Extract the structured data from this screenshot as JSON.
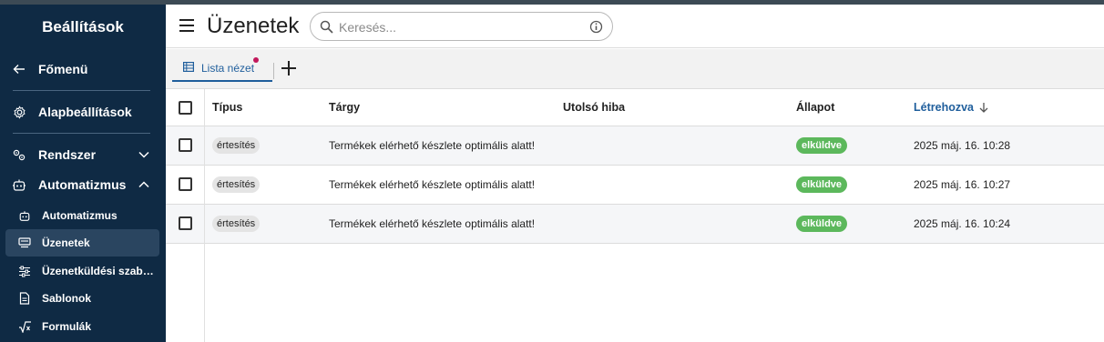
{
  "sidebar": {
    "title": "Beállítások",
    "back_label": "Főmenü",
    "items": [
      {
        "label": "Alapbeállítások"
      },
      {
        "label": "Rendszer"
      },
      {
        "label": "Automatizmus"
      }
    ],
    "subitems": [
      {
        "label": "Automatizmus"
      },
      {
        "label": "Üzenetek"
      },
      {
        "label": "Üzenetküldési szabályok"
      },
      {
        "label": "Sablonok"
      },
      {
        "label": "Formulák"
      }
    ]
  },
  "header": {
    "title": "Üzenetek",
    "search_placeholder": "Keresés..."
  },
  "tabs": [
    {
      "label": "Lista nézet"
    }
  ],
  "table": {
    "columns": {
      "type": "Típus",
      "subject": "Tárgy",
      "last_error": "Utolsó hiba",
      "status": "Állapot",
      "created": "Létrehozva"
    },
    "rows": [
      {
        "type": "értesítés",
        "subject": "Termékek elérhető készlete optimális alatt!",
        "last_error": "",
        "status": "elküldve",
        "created": "2025 máj. 16. 10:28"
      },
      {
        "type": "értesítés",
        "subject": "Termékek elérhető készlete optimális alatt!",
        "last_error": "",
        "status": "elküldve",
        "created": "2025 máj. 16. 10:27"
      },
      {
        "type": "értesítés",
        "subject": "Termékek elérhető készlete optimális alatt!",
        "last_error": "",
        "status": "elküldve",
        "created": "2025 máj. 16. 10:24"
      }
    ]
  },
  "colors": {
    "sidebar_bg": "#0f2a44",
    "accent": "#1f5e9c",
    "status_sent": "#5cb85c"
  }
}
